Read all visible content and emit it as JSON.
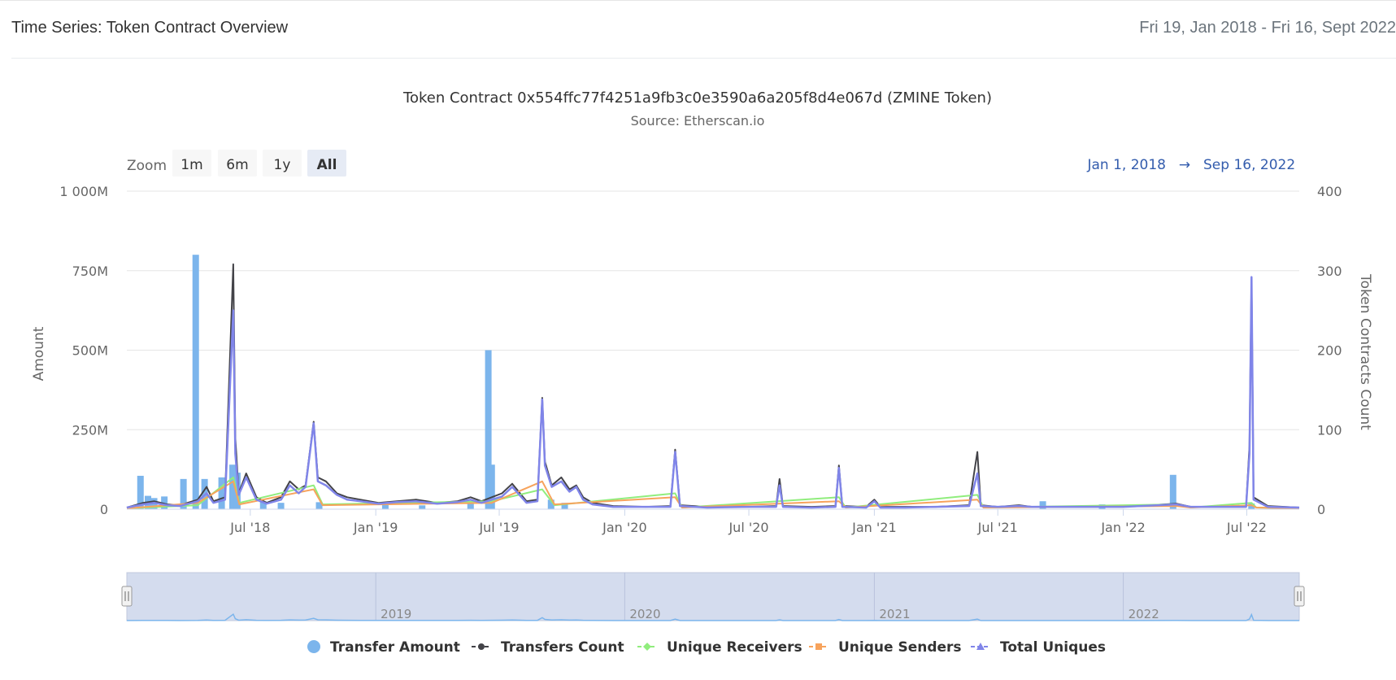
{
  "header": {
    "title": "Time Series: Token Contract Overview",
    "date_range": "Fri 19, Jan 2018 - Fri 16, Sept 2022"
  },
  "colors": {
    "transfer_amount": "#7cb5ec",
    "transfers_count": "#434348",
    "unique_receivers": "#90ed7d",
    "unique_senders": "#f7a35c",
    "total_uniques": "#8085e9",
    "range_text": "#335cad",
    "navigator_fill": "#ccd6eb",
    "grid": "#e6e6e6"
  },
  "range_selector": {
    "zoom_label": "Zoom",
    "buttons": [
      {
        "label": "1m",
        "selected": false
      },
      {
        "label": "6m",
        "selected": false
      },
      {
        "label": "1y",
        "selected": false
      },
      {
        "label": "All",
        "selected": true
      }
    ],
    "from": "Jan 1, 2018",
    "arrow": "→",
    "to": "Sep 16, 2022"
  },
  "chart_data": {
    "type": "line",
    "title": "Token Contract 0x554ffc77f4251a9fb3c0e3590a6a205f8d4e067d (ZMINE Token)",
    "subtitle": "Source: Etherscan.io",
    "x_range": [
      "2018-01-01",
      "2022-09-16"
    ],
    "x_ticks": [
      {
        "date": "2018-07-01",
        "label": "Jul '18"
      },
      {
        "date": "2019-01-01",
        "label": "Jan '19"
      },
      {
        "date": "2019-07-01",
        "label": "Jul '19"
      },
      {
        "date": "2020-01-01",
        "label": "Jan '20"
      },
      {
        "date": "2020-07-01",
        "label": "Jul '20"
      },
      {
        "date": "2021-01-01",
        "label": "Jan '21"
      },
      {
        "date": "2021-07-01",
        "label": "Jul '21"
      },
      {
        "date": "2022-01-01",
        "label": "Jan '22"
      },
      {
        "date": "2022-07-01",
        "label": "Jul '22"
      }
    ],
    "y_left": {
      "label": "Amount",
      "range": [
        0,
        1000
      ],
      "ticks": [
        0,
        250,
        500,
        750,
        1000
      ],
      "tick_labels": [
        "0",
        "250M",
        "500M",
        "750M",
        "1 000M"
      ]
    },
    "y_right": {
      "label": "Token Contracts Count",
      "range": [
        0,
        400
      ],
      "ticks": [
        0,
        100,
        200,
        300,
        400
      ],
      "tick_labels": [
        "0",
        "100",
        "200",
        "300",
        "400"
      ]
    },
    "grid": true,
    "legend_position": "bottom-center",
    "navigator": {
      "labels": [
        {
          "date": "2019-01-01",
          "label": "2019"
        },
        {
          "date": "2020-01-01",
          "label": "2020"
        },
        {
          "date": "2021-01-01",
          "label": "2021"
        },
        {
          "date": "2022-01-01",
          "label": "2022"
        }
      ]
    },
    "series": [
      {
        "name": "Transfer Amount",
        "type": "column",
        "axis": "left",
        "unit": "M",
        "points": [
          [
            "2018-01-21",
            105
          ],
          [
            "2018-02-01",
            42
          ],
          [
            "2018-02-10",
            35
          ],
          [
            "2018-02-25",
            40
          ],
          [
            "2018-03-25",
            95
          ],
          [
            "2018-04-12",
            800
          ],
          [
            "2018-04-25",
            95
          ],
          [
            "2018-05-20",
            100
          ],
          [
            "2018-06-05",
            140
          ],
          [
            "2018-06-12",
            115
          ],
          [
            "2018-07-20",
            25
          ],
          [
            "2018-08-15",
            20
          ],
          [
            "2018-10-10",
            22
          ],
          [
            "2019-01-15",
            15
          ],
          [
            "2019-03-10",
            12
          ],
          [
            "2019-05-20",
            18
          ],
          [
            "2019-06-15",
            500
          ],
          [
            "2019-06-20",
            140
          ],
          [
            "2019-09-15",
            30
          ],
          [
            "2019-10-05",
            20
          ],
          [
            "2021-09-05",
            25
          ],
          [
            "2021-12-01",
            15
          ],
          [
            "2022-03-15",
            108
          ],
          [
            "2022-07-08",
            18
          ]
        ]
      },
      {
        "name": "Transfers Count",
        "type": "line",
        "axis": "right",
        "points": [
          [
            "2018-01-01",
            2
          ],
          [
            "2018-01-25",
            8
          ],
          [
            "2018-02-10",
            10
          ],
          [
            "2018-03-01",
            6
          ],
          [
            "2018-03-20",
            5
          ],
          [
            "2018-04-15",
            12
          ],
          [
            "2018-04-28",
            28
          ],
          [
            "2018-05-08",
            10
          ],
          [
            "2018-05-25",
            15
          ],
          [
            "2018-06-06",
            308
          ],
          [
            "2018-06-09",
            90
          ],
          [
            "2018-06-14",
            20
          ],
          [
            "2018-06-25",
            45
          ],
          [
            "2018-07-10",
            15
          ],
          [
            "2018-07-25",
            8
          ],
          [
            "2018-08-15",
            15
          ],
          [
            "2018-08-28",
            35
          ],
          [
            "2018-09-10",
            25
          ],
          [
            "2018-09-20",
            30
          ],
          [
            "2018-10-02",
            110
          ],
          [
            "2018-10-08",
            40
          ],
          [
            "2018-10-20",
            35
          ],
          [
            "2018-11-05",
            20
          ],
          [
            "2018-11-20",
            15
          ],
          [
            "2018-12-10",
            12
          ],
          [
            "2019-01-05",
            8
          ],
          [
            "2019-02-01",
            10
          ],
          [
            "2019-03-01",
            12
          ],
          [
            "2019-04-01",
            8
          ],
          [
            "2019-05-01",
            10
          ],
          [
            "2019-05-20",
            15
          ],
          [
            "2019-06-05",
            10
          ],
          [
            "2019-06-20",
            15
          ],
          [
            "2019-07-05",
            20
          ],
          [
            "2019-07-20",
            32
          ],
          [
            "2019-08-10",
            10
          ],
          [
            "2019-08-26",
            12
          ],
          [
            "2019-09-02",
            140
          ],
          [
            "2019-09-06",
            60
          ],
          [
            "2019-09-16",
            30
          ],
          [
            "2019-09-30",
            40
          ],
          [
            "2019-10-12",
            25
          ],
          [
            "2019-10-22",
            30
          ],
          [
            "2019-11-01",
            15
          ],
          [
            "2019-11-15",
            8
          ],
          [
            "2019-12-15",
            4
          ],
          [
            "2020-02-01",
            3
          ],
          [
            "2020-03-08",
            4
          ],
          [
            "2020-03-15",
            75
          ],
          [
            "2020-03-22",
            5
          ],
          [
            "2020-05-01",
            3
          ],
          [
            "2020-07-01",
            3
          ],
          [
            "2020-08-10",
            4
          ],
          [
            "2020-08-15",
            38
          ],
          [
            "2020-08-20",
            4
          ],
          [
            "2020-10-01",
            3
          ],
          [
            "2020-11-05",
            4
          ],
          [
            "2020-11-10",
            55
          ],
          [
            "2020-11-15",
            4
          ],
          [
            "2020-12-20",
            3
          ],
          [
            "2021-01-01",
            12
          ],
          [
            "2021-01-10",
            3
          ],
          [
            "2021-02-15",
            3
          ],
          [
            "2021-04-01",
            3
          ],
          [
            "2021-05-20",
            5
          ],
          [
            "2021-06-01",
            72
          ],
          [
            "2021-06-06",
            5
          ],
          [
            "2021-07-01",
            3
          ],
          [
            "2021-08-01",
            5
          ],
          [
            "2021-08-20",
            3
          ],
          [
            "2022-01-01",
            3
          ],
          [
            "2022-03-20",
            7
          ],
          [
            "2022-04-10",
            3
          ],
          [
            "2022-06-30",
            3
          ],
          [
            "2022-07-05",
            80
          ],
          [
            "2022-07-08",
            290
          ],
          [
            "2022-07-11",
            15
          ],
          [
            "2022-08-01",
            4
          ],
          [
            "2022-09-16",
            2
          ]
        ]
      },
      {
        "name": "Unique Receivers",
        "type": "line",
        "axis": "right",
        "points": [
          [
            "2018-01-01",
            1
          ],
          [
            "2018-04-15",
            5
          ],
          [
            "2018-06-06",
            40
          ],
          [
            "2018-06-15",
            8
          ],
          [
            "2018-10-02",
            30
          ],
          [
            "2018-10-15",
            6
          ],
          [
            "2019-06-20",
            10
          ],
          [
            "2019-09-02",
            25
          ],
          [
            "2019-09-20",
            5
          ],
          [
            "2020-03-15",
            20
          ],
          [
            "2020-03-25",
            2
          ],
          [
            "2020-11-10",
            15
          ],
          [
            "2020-11-20",
            2
          ],
          [
            "2021-06-01",
            18
          ],
          [
            "2021-06-10",
            2
          ],
          [
            "2022-03-20",
            6
          ],
          [
            "2022-04-10",
            2
          ],
          [
            "2022-07-08",
            8
          ],
          [
            "2022-07-15",
            2
          ],
          [
            "2022-09-16",
            1
          ]
        ]
      },
      {
        "name": "Unique Senders",
        "type": "line",
        "axis": "right",
        "points": [
          [
            "2018-01-01",
            1
          ],
          [
            "2018-04-15",
            8
          ],
          [
            "2018-06-06",
            35
          ],
          [
            "2018-06-15",
            6
          ],
          [
            "2018-10-02",
            25
          ],
          [
            "2018-10-15",
            5
          ],
          [
            "2019-06-20",
            8
          ],
          [
            "2019-09-02",
            35
          ],
          [
            "2019-09-20",
            6
          ],
          [
            "2020-03-15",
            15
          ],
          [
            "2020-03-25",
            2
          ],
          [
            "2020-11-10",
            10
          ],
          [
            "2020-11-20",
            2
          ],
          [
            "2021-06-01",
            12
          ],
          [
            "2021-06-10",
            2
          ],
          [
            "2022-03-20",
            4
          ],
          [
            "2022-04-10",
            2
          ],
          [
            "2022-07-08",
            5
          ],
          [
            "2022-07-15",
            2
          ],
          [
            "2022-09-16",
            1
          ]
        ]
      },
      {
        "name": "Total Uniques",
        "type": "line",
        "axis": "right",
        "points": [
          [
            "2018-01-01",
            2
          ],
          [
            "2018-01-25",
            6
          ],
          [
            "2018-02-10",
            8
          ],
          [
            "2018-03-01",
            5
          ],
          [
            "2018-03-20",
            4
          ],
          [
            "2018-04-15",
            10
          ],
          [
            "2018-04-28",
            20
          ],
          [
            "2018-05-08",
            8
          ],
          [
            "2018-05-25",
            12
          ],
          [
            "2018-06-06",
            250
          ],
          [
            "2018-06-09",
            70
          ],
          [
            "2018-06-14",
            18
          ],
          [
            "2018-06-25",
            40
          ],
          [
            "2018-07-10",
            12
          ],
          [
            "2018-07-25",
            7
          ],
          [
            "2018-08-15",
            12
          ],
          [
            "2018-08-28",
            30
          ],
          [
            "2018-09-10",
            20
          ],
          [
            "2018-09-20",
            28
          ],
          [
            "2018-10-02",
            108
          ],
          [
            "2018-10-08",
            35
          ],
          [
            "2018-10-20",
            30
          ],
          [
            "2018-11-05",
            18
          ],
          [
            "2018-11-20",
            12
          ],
          [
            "2018-12-10",
            10
          ],
          [
            "2019-01-05",
            7
          ],
          [
            "2019-02-01",
            9
          ],
          [
            "2019-03-01",
            10
          ],
          [
            "2019-04-01",
            7
          ],
          [
            "2019-05-01",
            9
          ],
          [
            "2019-05-20",
            12
          ],
          [
            "2019-06-05",
            8
          ],
          [
            "2019-06-20",
            12
          ],
          [
            "2019-07-05",
            16
          ],
          [
            "2019-07-20",
            28
          ],
          [
            "2019-08-10",
            8
          ],
          [
            "2019-08-26",
            10
          ],
          [
            "2019-09-02",
            138
          ],
          [
            "2019-09-06",
            55
          ],
          [
            "2019-09-16",
            28
          ],
          [
            "2019-09-30",
            35
          ],
          [
            "2019-10-12",
            22
          ],
          [
            "2019-10-22",
            28
          ],
          [
            "2019-11-01",
            12
          ],
          [
            "2019-11-15",
            6
          ],
          [
            "2019-12-15",
            3
          ],
          [
            "2020-02-01",
            3
          ],
          [
            "2020-03-08",
            3
          ],
          [
            "2020-03-15",
            72
          ],
          [
            "2020-03-22",
            4
          ],
          [
            "2020-05-01",
            2
          ],
          [
            "2020-07-01",
            3
          ],
          [
            "2020-08-10",
            3
          ],
          [
            "2020-08-15",
            30
          ],
          [
            "2020-08-20",
            3
          ],
          [
            "2020-10-01",
            2
          ],
          [
            "2020-11-05",
            3
          ],
          [
            "2020-11-10",
            52
          ],
          [
            "2020-11-15",
            3
          ],
          [
            "2020-12-20",
            2
          ],
          [
            "2021-01-01",
            10
          ],
          [
            "2021-01-10",
            2
          ],
          [
            "2021-02-15",
            2
          ],
          [
            "2021-04-01",
            3
          ],
          [
            "2021-05-20",
            4
          ],
          [
            "2021-06-01",
            45
          ],
          [
            "2021-06-06",
            4
          ],
          [
            "2021-07-01",
            3
          ],
          [
            "2021-08-01",
            4
          ],
          [
            "2021-08-20",
            3
          ],
          [
            "2022-01-01",
            3
          ],
          [
            "2022-03-20",
            6
          ],
          [
            "2022-04-10",
            3
          ],
          [
            "2022-06-30",
            3
          ],
          [
            "2022-07-05",
            70
          ],
          [
            "2022-07-08",
            292
          ],
          [
            "2022-07-11",
            12
          ],
          [
            "2022-08-01",
            3
          ],
          [
            "2022-09-16",
            2
          ]
        ]
      }
    ]
  }
}
